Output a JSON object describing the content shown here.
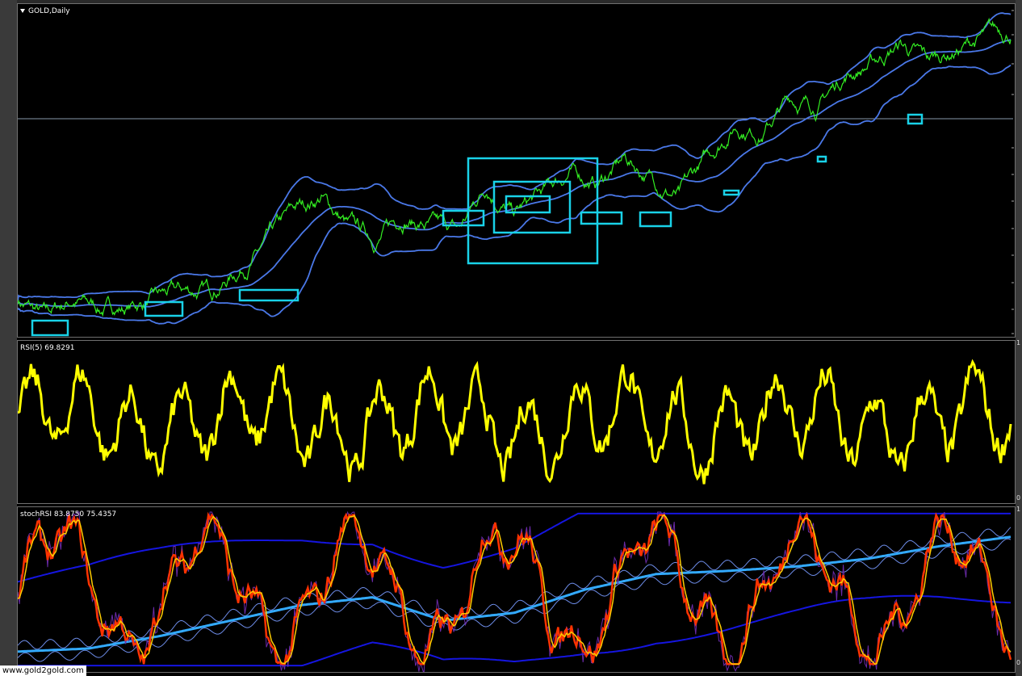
{
  "price_pane": {
    "label": "GOLD,Daily"
  },
  "rsi_pane": {
    "label": "RSI(5) 69.8291",
    "scale_top": "1",
    "scale_bottom": "0"
  },
  "stoch_pane": {
    "label": "stochRSI 83.8750 75.4357",
    "scale_top": "1",
    "scale_bottom": "0"
  },
  "watermark": "www.gold2gold.com",
  "colors": {
    "price": "#33ee22",
    "bands": "#4a78e8",
    "boxes": "#19d2e8",
    "rsi": "#ffff00",
    "stoch_fast": "#ffcc00",
    "stoch_slow": "#ff3300",
    "stoch_bands": "#1515e0"
  },
  "chart_data": [
    {
      "type": "line",
      "title": "GOLD,Daily",
      "series": [
        {
          "name": "GOLD,Daily",
          "values": [
            330,
            300,
            330,
            316,
            318,
            332,
            340,
            345,
            380,
            420,
            470,
            500,
            450,
            430,
            470,
            450,
            440,
            520,
            470,
            500,
            540,
            520,
            560,
            530,
            500,
            560,
            620,
            610,
            660,
            650,
            700,
            720,
            750,
            720,
            740,
            760,
            770
          ]
        }
      ]
    },
    {
      "type": "line",
      "title": "RSI(5) 69.8291",
      "ylim": [
        0,
        100
      ],
      "series": [
        {
          "name": "RSI(5)",
          "values": [
            69.8291
          ]
        }
      ]
    },
    {
      "type": "line",
      "title": "stochRSI 83.8750 75.4357",
      "ylim": [
        0,
        100
      ],
      "series": [
        {
          "name": "stochRSI",
          "values": [
            83.875,
            75.4357
          ]
        }
      ]
    }
  ]
}
